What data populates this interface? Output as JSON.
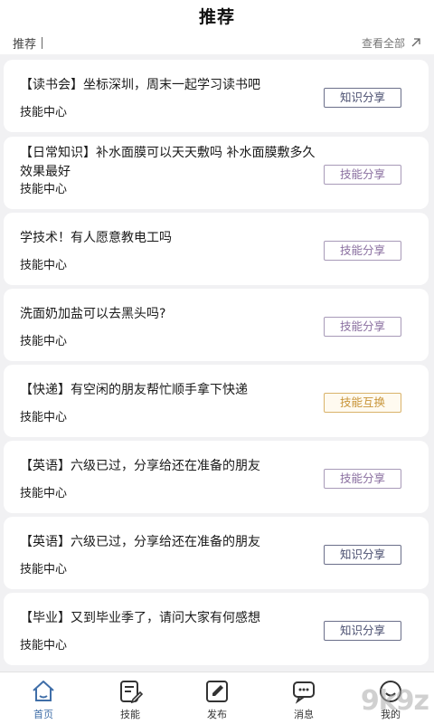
{
  "header": {
    "title": "推荐"
  },
  "subbar": {
    "left_label": "推荐",
    "right_label": "查看全部"
  },
  "cards": [
    {
      "title": "【读书会】坐标深圳，周末一起学习读书吧",
      "category": "技能中心",
      "tag": "知识分享",
      "tag_type": "knowledge"
    },
    {
      "title": "【日常知识】补水面膜可以天天敷吗 补水面膜敷多久效果最好",
      "category": "技能中心",
      "tag": "技能分享",
      "tag_type": "skill"
    },
    {
      "title": "学技术！有人愿意教电工吗",
      "category": "技能中心",
      "tag": "技能分享",
      "tag_type": "skill"
    },
    {
      "title": "洗面奶加盐可以去黑头吗?",
      "category": "技能中心",
      "tag": "技能分享",
      "tag_type": "skill"
    },
    {
      "title": "【快递】有空闲的朋友帮忙顺手拿下快递",
      "category": "技能中心",
      "tag": "技能互换",
      "tag_type": "exchange"
    },
    {
      "title": "【英语】六级已过，分享给还在准备的朋友",
      "category": "技能中心",
      "tag": "技能分享",
      "tag_type": "skill"
    },
    {
      "title": "【英语】六级已过，分享给还在准备的朋友",
      "category": "技能中心",
      "tag": "知识分享",
      "tag_type": "knowledge"
    },
    {
      "title": "【毕业】又到毕业季了，请问大家有何感想",
      "category": "技能中心",
      "tag": "知识分享",
      "tag_type": "knowledge"
    }
  ],
  "tabbar": {
    "items": [
      {
        "label": "首页",
        "icon": "home-icon",
        "active": true
      },
      {
        "label": "技能",
        "icon": "skill-edit-icon",
        "active": false
      },
      {
        "label": "发布",
        "icon": "publish-pen-icon",
        "active": false
      },
      {
        "label": "消息",
        "icon": "message-icon",
        "active": false
      },
      {
        "label": "我的",
        "icon": "profile-icon",
        "active": false
      }
    ]
  },
  "watermark": {
    "text": "9k9z"
  },
  "colors": {
    "active_tab": "#3f6ea8",
    "knowledge_tag": "#4a4f70",
    "skill_tag": "#8a6fa0",
    "exchange_tag": "#c8953a"
  }
}
